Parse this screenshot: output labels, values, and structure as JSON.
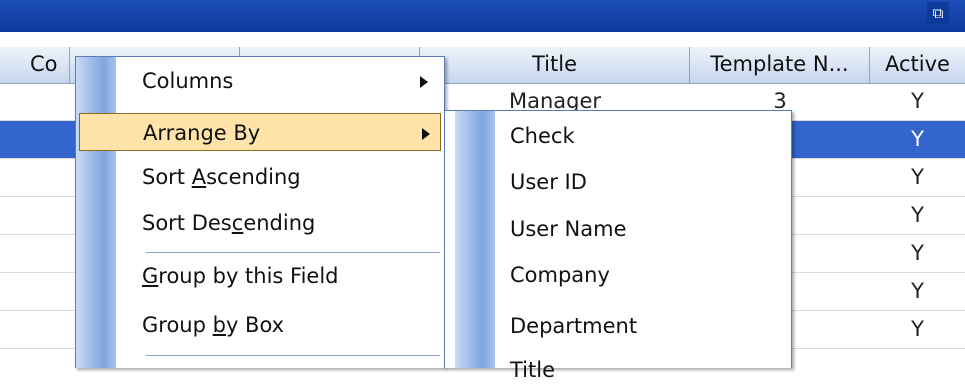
{
  "window": {
    "button_glyph": "⧉"
  },
  "grid": {
    "columns": [
      "Co",
      "",
      "",
      "Title",
      "Template N...",
      "Active"
    ],
    "rows": [
      {
        "title": "Manager",
        "template": "3",
        "active": "Y",
        "selected": false
      },
      {
        "title": "",
        "template": "",
        "active": "Y",
        "selected": true
      },
      {
        "title": "",
        "template": "",
        "active": "Y",
        "selected": false
      },
      {
        "title": "",
        "template": "",
        "active": "Y",
        "selected": false
      },
      {
        "title": "",
        "template": "",
        "active": "Y",
        "selected": false
      },
      {
        "title": "",
        "template": "",
        "active": "Y",
        "selected": false
      },
      {
        "title": "",
        "template": "",
        "active": "Y",
        "selected": false
      }
    ]
  },
  "context_menu": {
    "items": [
      {
        "label": "Columns",
        "submenu": true
      },
      {
        "label": "Arrange By",
        "submenu": true,
        "highlighted": true
      },
      {
        "label_parts": [
          "Sort ",
          "A",
          "scending"
        ]
      },
      {
        "label_parts": [
          "Sort Des",
          "c",
          "ending"
        ]
      },
      {
        "label_parts": [
          "",
          "G",
          "roup by this Field"
        ]
      },
      {
        "label_parts": [
          "Group ",
          "b",
          "y Box"
        ]
      }
    ]
  },
  "submenu": {
    "items": [
      "Check",
      "User ID",
      "User Name",
      "Company",
      "Department",
      "Title"
    ]
  },
  "colors": {
    "selection": "#3365cc",
    "titlebar": "#0a3a9c",
    "menu_highlight": "#ffe3a8"
  }
}
